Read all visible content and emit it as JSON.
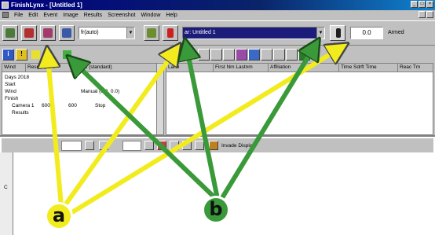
{
  "window": {
    "title": "FinishLynx - [Untitled 1]",
    "min_glyph": "_",
    "max_glyph": "□",
    "close_glyph": "×"
  },
  "menu": [
    "File",
    "Edit",
    "Event",
    "Image",
    "Results",
    "Screenshot",
    "Window",
    "Help"
  ],
  "toolbar": {
    "frame_rate_combo": "fr(auto)",
    "event_combo": "ar: Untitled 1",
    "time_readout": "0.0",
    "status_label": "Armed"
  },
  "toolbar2": {
    "info_glyph": "i",
    "alert_glyph": "!"
  },
  "left_pane": {
    "headers": [
      "Wind",
      "Results",
      "Mode (standard)"
    ],
    "rows": [
      {
        "label": "Days 2018"
      },
      {
        "label": "Start"
      },
      {
        "label": "Wind",
        "mode": "Manual (0.0, 0.0)"
      },
      {
        "label": "Finish"
      },
      {
        "label": "Camera 1",
        "c1": "600",
        "c2": "600",
        "c3": "Stop"
      },
      {
        "label": "Results"
      }
    ]
  },
  "right_pane": {
    "headers": [
      "Lane",
      "First Nm Lastnm",
      "Affiliation",
      "Time Sdrft Time",
      "Reac Tm"
    ]
  },
  "lower_pane": {
    "invert_label": "Invade Display",
    "ruler_mark": "C"
  },
  "callouts": [
    {
      "label": "a",
      "color": "#f2ec1f"
    },
    {
      "label": "b",
      "color": "#3a9a3a"
    }
  ],
  "colors": {
    "chrome": "#c0c0c0",
    "title_bar": "#000080",
    "arrow_a": "#f2ec1f",
    "arrow_b": "#3a9a3a"
  }
}
